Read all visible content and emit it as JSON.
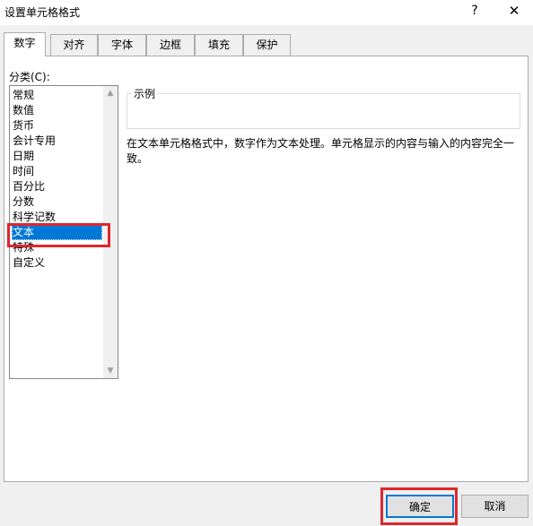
{
  "window": {
    "title": "设置单元格格式",
    "help_glyph": "?",
    "close_glyph": "✕"
  },
  "tabs": [
    {
      "label": "数字",
      "active": true
    },
    {
      "label": "对齐",
      "active": false
    },
    {
      "label": "字体",
      "active": false
    },
    {
      "label": "边框",
      "active": false
    },
    {
      "label": "填充",
      "active": false
    },
    {
      "label": "保护",
      "active": false
    }
  ],
  "category": {
    "label": "分类(C):",
    "items": [
      "常规",
      "数值",
      "货币",
      "会计专用",
      "日期",
      "时间",
      "百分比",
      "分数",
      "科学记数",
      "文本",
      "特殊",
      "自定义"
    ],
    "selected": "文本"
  },
  "sample": {
    "label": "示例"
  },
  "description": "在文本单元格格式中，数字作为文本处理。单元格显示的内容与输入的内容完全一致。",
  "buttons": {
    "ok": "确定",
    "cancel": "取消"
  },
  "colors": {
    "highlight": "#e0262c",
    "selection": "#0078d7"
  }
}
